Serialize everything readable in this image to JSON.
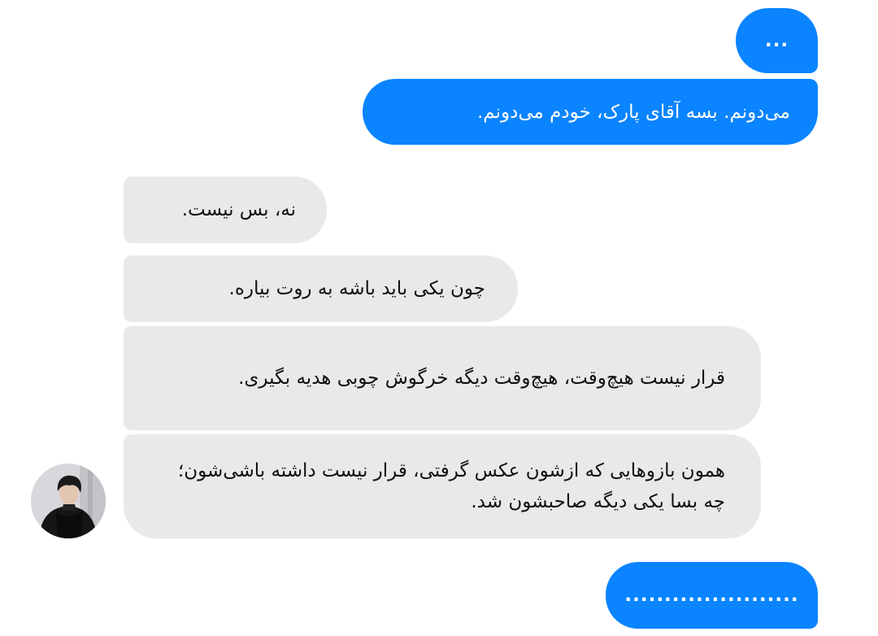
{
  "messages": [
    {
      "id": "m1",
      "direction": "outgoing",
      "text": "..."
    },
    {
      "id": "m2",
      "direction": "outgoing",
      "text": "می‌دونم. بسه آقای پارک، خودم می‌دونم."
    },
    {
      "id": "m3",
      "direction": "incoming",
      "text": "نه، بس نیست."
    },
    {
      "id": "m4",
      "direction": "incoming",
      "text": "چون یکی باید باشه به روت بیاره."
    },
    {
      "id": "m5",
      "direction": "incoming",
      "text": "قرار نیست هیچ‌وقت، هیچ‌وقت دیگه خرگوش چوبی هدیه بگیری."
    },
    {
      "id": "m6",
      "direction": "incoming",
      "text": "همون بازوهایی که ازشون عکس گرفتی، قرار نیست داشته باشی‌شون؛ چه بسا یکی دیگه صاحبشون شد."
    },
    {
      "id": "m7",
      "direction": "outgoing",
      "text": "......................"
    }
  ],
  "colors": {
    "outgoing_bubble": "#0a84ff",
    "incoming_bubble": "#e9e9eb",
    "outgoing_text": "#ffffff",
    "incoming_text": "#111111"
  },
  "avatar": {
    "icon": "contact-avatar-photo"
  }
}
